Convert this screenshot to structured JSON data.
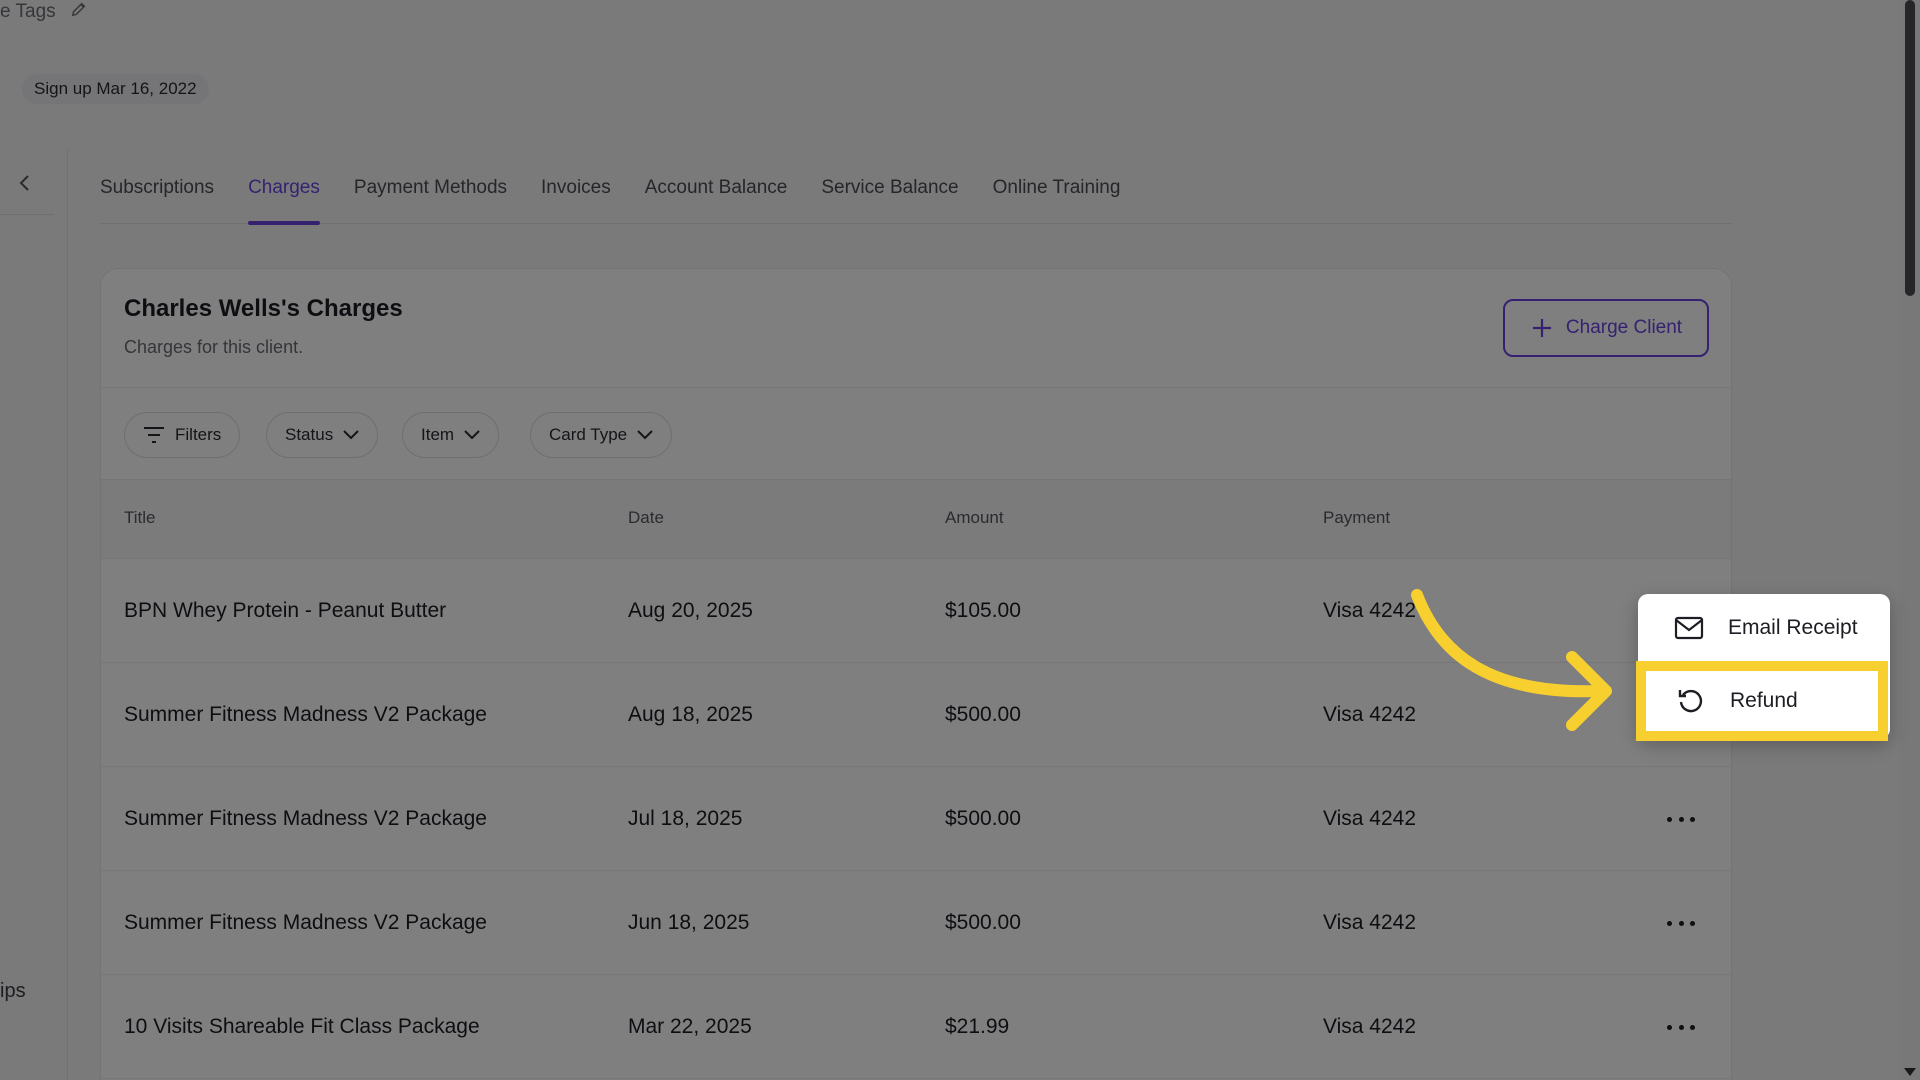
{
  "header": {
    "tags_label": "e Tags",
    "signup_label": "Sign up Mar 16, 2022"
  },
  "left_rail": {
    "partial_text": "ips"
  },
  "tabs": [
    {
      "label": "Subscriptions",
      "active": false
    },
    {
      "label": "Charges",
      "active": true
    },
    {
      "label": "Payment Methods",
      "active": false
    },
    {
      "label": "Invoices",
      "active": false
    },
    {
      "label": "Account Balance",
      "active": false
    },
    {
      "label": "Service Balance",
      "active": false
    },
    {
      "label": "Online Training",
      "active": false
    }
  ],
  "card": {
    "title": "Charles Wells's Charges",
    "subtitle": "Charges for this client.",
    "charge_button": "Charge Client"
  },
  "filters": {
    "filters_label": "Filters",
    "status_label": "Status",
    "item_label": "Item",
    "card_type_label": "Card Type"
  },
  "table": {
    "columns": [
      "Title",
      "Date",
      "Amount",
      "Payment"
    ],
    "rows": [
      {
        "title": "BPN Whey Protein - Peanut Butter",
        "date": "Aug 20, 2025",
        "amount": "$105.00",
        "payment": "Visa 4242"
      },
      {
        "title": "Summer Fitness Madness V2 Package",
        "date": "Aug 18, 2025",
        "amount": "$500.00",
        "payment": "Visa 4242"
      },
      {
        "title": "Summer Fitness Madness V2 Package",
        "date": "Jul 18, 2025",
        "amount": "$500.00",
        "payment": "Visa 4242"
      },
      {
        "title": "Summer Fitness Madness V2 Package",
        "date": "Jun 18, 2025",
        "amount": "$500.00",
        "payment": "Visa 4242"
      },
      {
        "title": "10 Visits Shareable Fit Class Package",
        "date": "Mar 22, 2025",
        "amount": "$21.99",
        "payment": "Visa 4242"
      }
    ]
  },
  "menu": {
    "email_receipt": "Email Receipt",
    "refund": "Refund"
  },
  "colors": {
    "accent": "#6a43e0",
    "highlight": "#f7d02f"
  }
}
